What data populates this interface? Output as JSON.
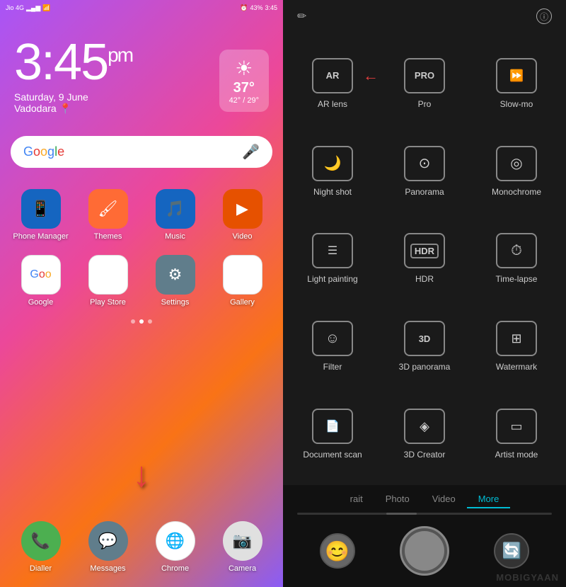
{
  "left": {
    "status": {
      "carrier": "Jio 4G",
      "time": "3:45",
      "battery": "43%",
      "battery_icon": "🔋",
      "signal": "▂▄▆"
    },
    "clock": {
      "time": "3:45",
      "period": "pm",
      "date": "Saturday, 9 June",
      "location": "Vadodara"
    },
    "weather": {
      "icon": "☀",
      "temp": "37°",
      "range": "42° / 29°"
    },
    "search": {
      "text": "Google",
      "mic_icon": "🎤"
    },
    "apps_row1": [
      {
        "name": "Phone Manager",
        "label": "Phone Manager",
        "color": "#1e90ff",
        "icon": "📱"
      },
      {
        "name": "Themes",
        "label": "Themes",
        "color": "#ff6b35",
        "icon": "🖌"
      },
      {
        "name": "Music",
        "label": "Music",
        "color": "#1e90ff",
        "icon": "🎵"
      },
      {
        "name": "Video",
        "label": "Video",
        "color": "#ff8c00",
        "icon": "▶"
      }
    ],
    "apps_row2": [
      {
        "name": "Google",
        "label": "Google",
        "color": "#fff",
        "icon": "G"
      },
      {
        "name": "Play Store",
        "label": "Play Store",
        "color": "#fff",
        "icon": "▷"
      },
      {
        "name": "Settings",
        "label": "Settings",
        "color": "#777",
        "icon": "⚙"
      },
      {
        "name": "Gallery",
        "label": "Gallery",
        "color": "#fff",
        "icon": "🖼"
      }
    ],
    "dock": [
      {
        "name": "Dialler",
        "label": "Dialler",
        "color": "#4caf50",
        "icon": "📞"
      },
      {
        "name": "Messages",
        "label": "Messages",
        "color": "#607d8b",
        "icon": "💬"
      },
      {
        "name": "Chrome",
        "label": "Chrome",
        "color": "#fff",
        "icon": "🌐"
      },
      {
        "name": "Camera",
        "label": "Camera",
        "color": "#fff",
        "icon": "📷"
      }
    ]
  },
  "right": {
    "modes": [
      {
        "id": "ar-lens",
        "label": "AR lens",
        "icon": "AR",
        "type": "text-box"
      },
      {
        "id": "pro",
        "label": "Pro",
        "icon": "PRO",
        "type": "text-box",
        "has_arrow": true
      },
      {
        "id": "slow-mo",
        "label": "Slow-mo",
        "icon": "▶▶",
        "type": "icon-box"
      },
      {
        "id": "night-shot",
        "label": "Night shot",
        "icon": "🌙",
        "type": "icon-box"
      },
      {
        "id": "panorama",
        "label": "Panorama",
        "icon": "⊙",
        "type": "icon-box"
      },
      {
        "id": "monochrome",
        "label": "Monochrome",
        "icon": "◎",
        "type": "icon-box"
      },
      {
        "id": "light-painting",
        "label": "Light painting",
        "icon": "☰",
        "type": "icon-box"
      },
      {
        "id": "hdr",
        "label": "HDR",
        "icon": "HDR",
        "type": "hdr-box"
      },
      {
        "id": "time-lapse",
        "label": "Time-lapse",
        "icon": "⏱",
        "type": "icon-box"
      },
      {
        "id": "filter",
        "label": "Filter",
        "icon": "☺",
        "type": "icon-box"
      },
      {
        "id": "3d-panorama",
        "label": "3D panorama",
        "icon": "3D",
        "type": "text-box"
      },
      {
        "id": "watermark",
        "label": "Watermark",
        "icon": "⊞",
        "type": "icon-box"
      },
      {
        "id": "document-scan",
        "label": "Document scan",
        "icon": "☰",
        "type": "icon-box"
      },
      {
        "id": "3d-creator",
        "label": "3D Creator",
        "icon": "◈",
        "type": "icon-box"
      },
      {
        "id": "artist-mode",
        "label": "Artist mode",
        "icon": "▭",
        "type": "icon-box"
      }
    ],
    "tabs": [
      {
        "id": "portrait",
        "label": "rait",
        "active": false
      },
      {
        "id": "photo",
        "label": "Photo",
        "active": false
      },
      {
        "id": "video",
        "label": "Video",
        "active": false
      },
      {
        "id": "more",
        "label": "More",
        "active": true
      }
    ]
  }
}
